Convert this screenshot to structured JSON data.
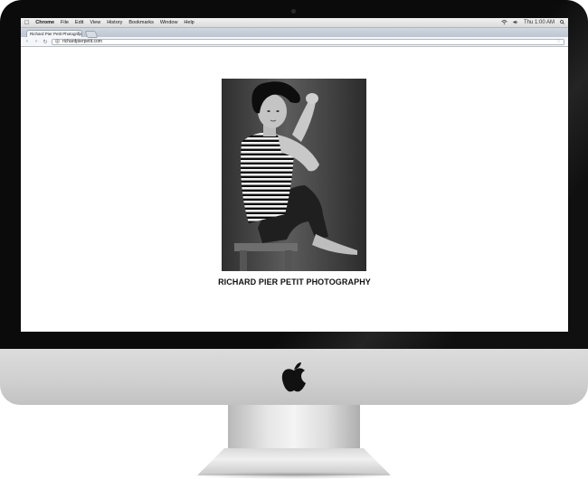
{
  "menubar": {
    "apple_glyph": "",
    "items": [
      "Chrome",
      "File",
      "Edit",
      "View",
      "History",
      "Bookmarks",
      "Window",
      "Help"
    ],
    "clock": "Thu 1:00 AM",
    "status_icons": [
      "wifi-icon",
      "volume-icon",
      "search-icon"
    ]
  },
  "browser": {
    "tab_title": "Richard Pier Petit Photograp",
    "tab_close": "×",
    "url": "richardpierpetit.com",
    "back_glyph": "‹",
    "forward_glyph": "›",
    "reload_glyph": "↻",
    "star_glyph": "☆"
  },
  "page": {
    "title": "RICHARD PIER PETIT PHOTOGRAPHY",
    "photo": "black-and-white portrait of a man in a striped shirt seated on a stool"
  },
  "colors": {
    "bezel": "#0b0b0b",
    "aluminium": "#d4d4d4",
    "page_background": "#ffffff",
    "title_text": "#111111"
  }
}
